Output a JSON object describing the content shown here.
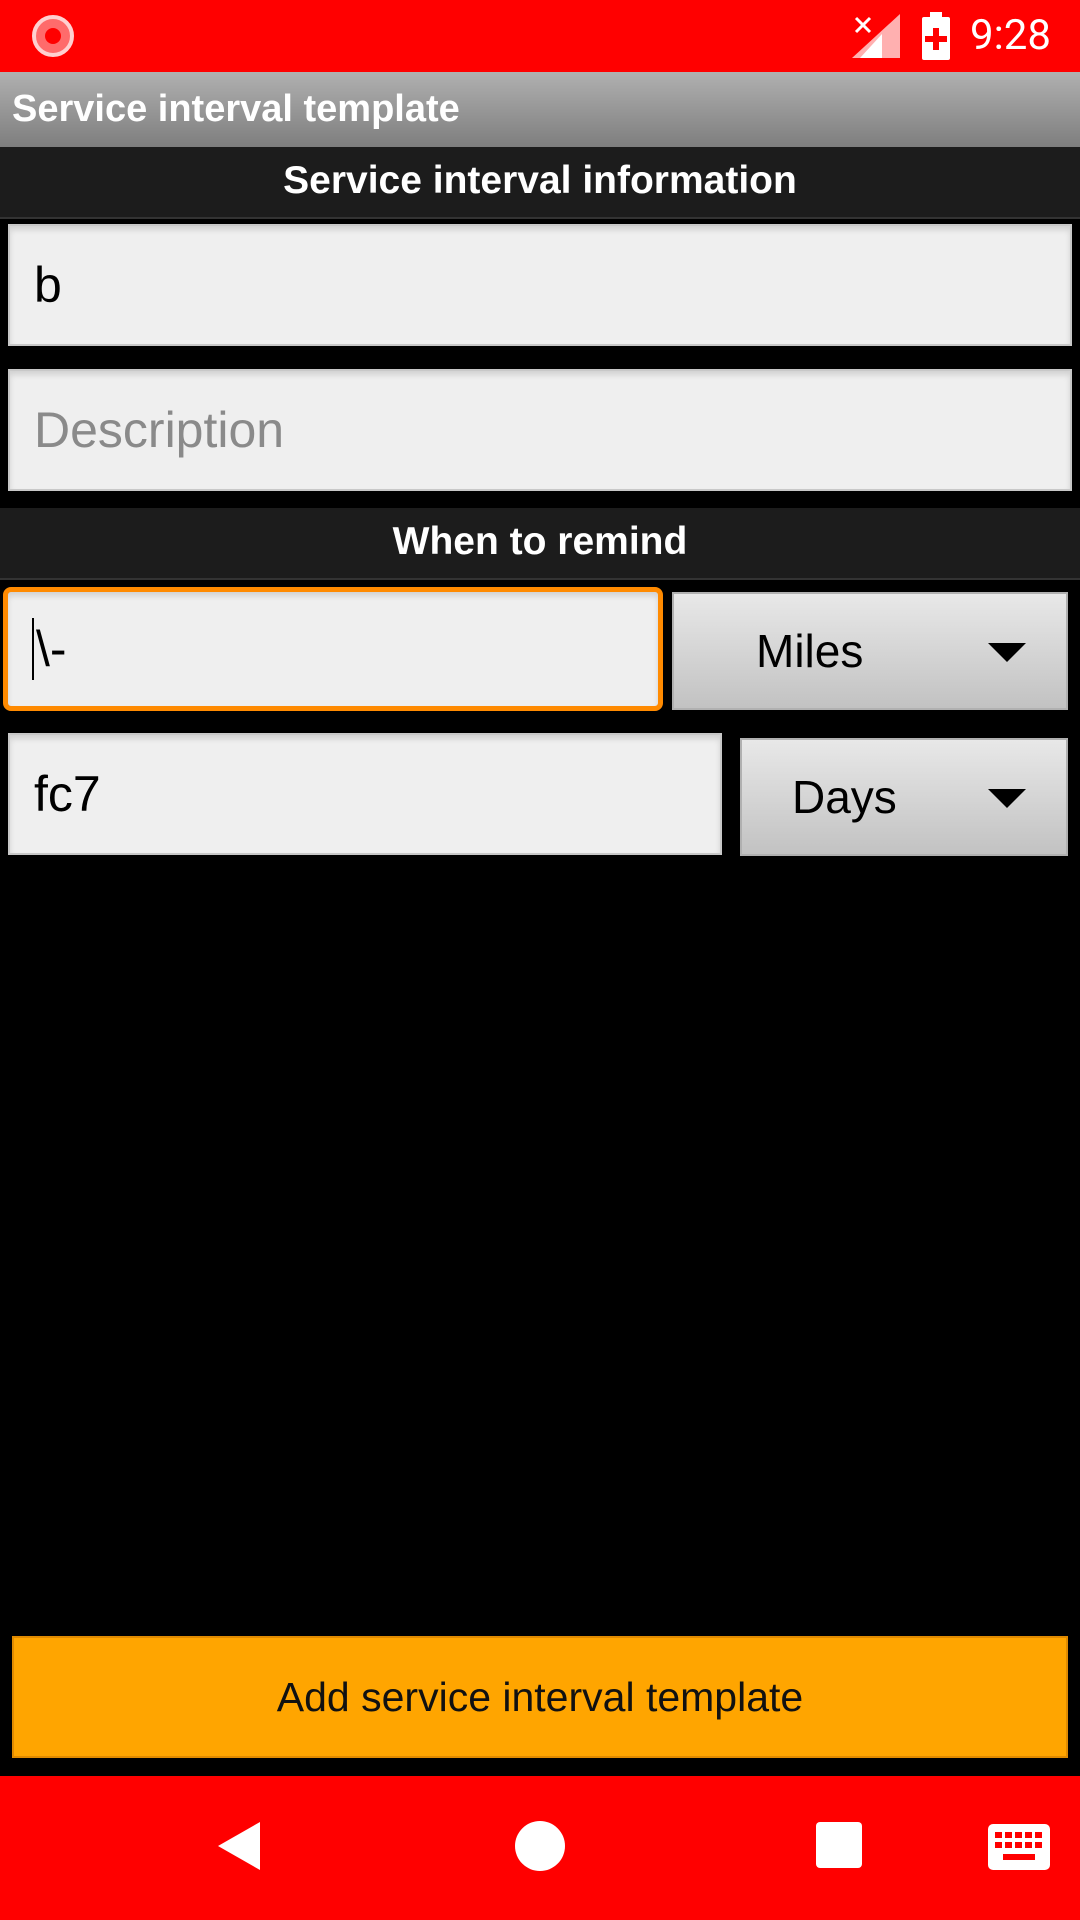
{
  "status_bar": {
    "time": "9:28",
    "icons": [
      "record-icon",
      "signal-off-icon",
      "battery-charging-icon"
    ]
  },
  "action_bar": {
    "title": "Service interval template"
  },
  "sections": {
    "info_header": "Service interval information",
    "remind_header": "When to remind"
  },
  "form": {
    "name_value": "b",
    "description_placeholder": "Description",
    "distance_value": "\\-",
    "distance_unit": "Miles",
    "time_value": "fc7",
    "time_unit": "Days"
  },
  "buttons": {
    "add_label": "Add service interval template"
  },
  "nav_bar": {
    "icons": [
      "back-icon",
      "home-icon",
      "recents-icon",
      "keyboard-icon"
    ]
  },
  "colors": {
    "status_bar": "#ff0000",
    "accent": "#ffa500",
    "focus_border": "#ff8a00"
  }
}
